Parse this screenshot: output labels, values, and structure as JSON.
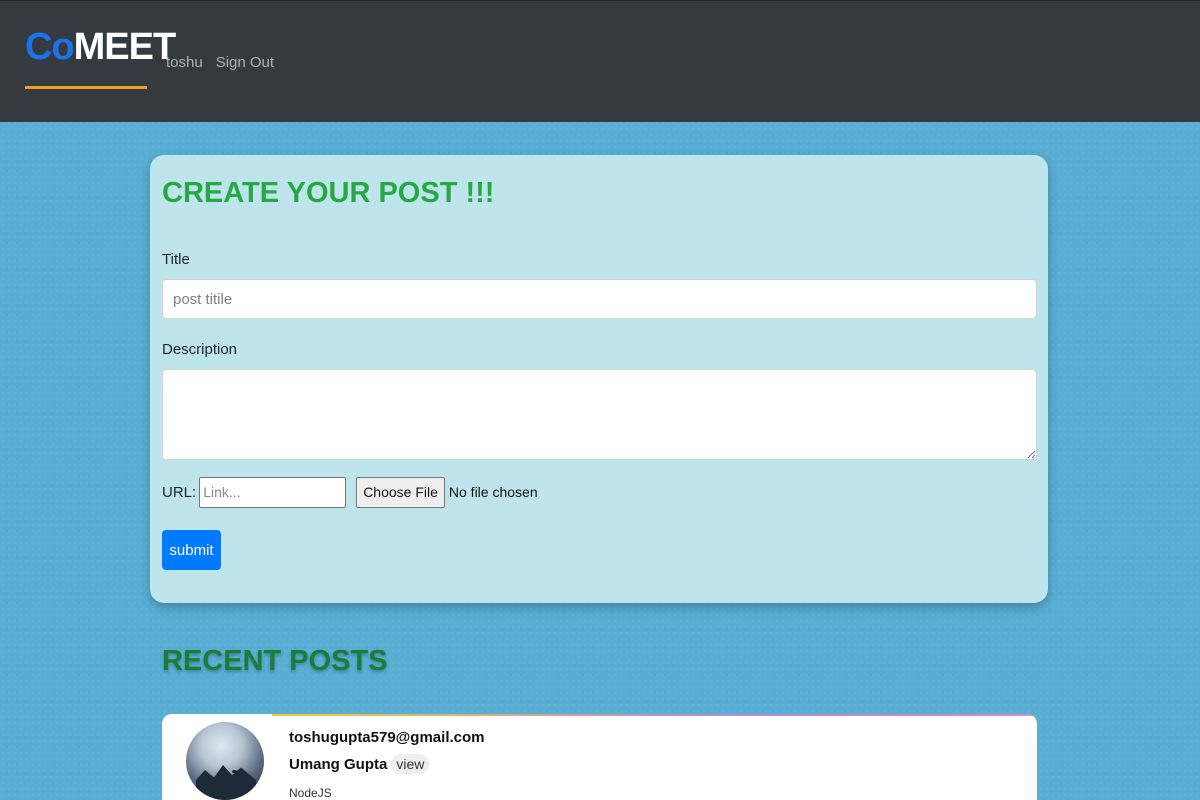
{
  "navbar": {
    "brand_part1": "Co",
    "brand_part2": "MEET",
    "links": [
      "toshu",
      "Sign Out"
    ],
    "colors": {
      "background": "#343a40",
      "brand_accent": "#1a73e8",
      "underline": "#f0a020"
    }
  },
  "create_post": {
    "heading": "CREATE YOUR POST !!!",
    "title_label": "Title",
    "title_placeholder": "post titile",
    "description_label": "Description",
    "url_label": "URL:",
    "url_placeholder": "Link...",
    "file_button": "Choose File",
    "file_status": "No file chosen",
    "submit_label": "submit",
    "colors": {
      "heading": "#28a745",
      "card": "#bee5eb",
      "submit": "#007bff"
    }
  },
  "recent_posts": {
    "heading": "RECENT POSTS",
    "items": [
      {
        "email": "toshugupta579@gmail.com",
        "name": "Umang Gupta",
        "view_label": "view",
        "tag": "NodeJS",
        "avatar_icon": "profile-photo"
      }
    ]
  }
}
